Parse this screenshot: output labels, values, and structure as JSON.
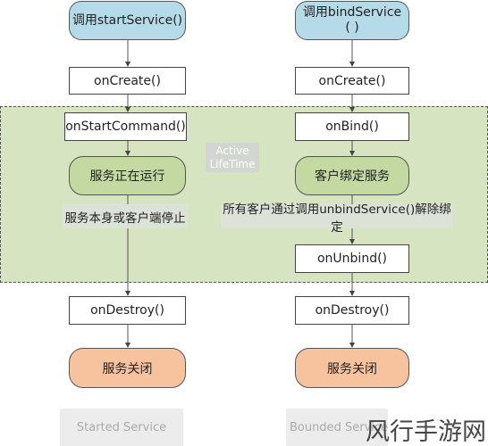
{
  "left": {
    "start": "调用startService()",
    "create": "onCreate()",
    "command": "onStartCommand()",
    "running": "服务正在运行",
    "stop_note": "服务本身或客户端停止",
    "destroy": "onDestroy()",
    "closed": "服务关闭",
    "footer": "Started Service"
  },
  "right": {
    "start": "调用bindService\n( )",
    "create": "onCreate()",
    "bind": "onBind()",
    "bound": "客户绑定服务",
    "unbind_note": "所有客户通过调用unbindService()解除绑定",
    "unbind": "onUnbind()",
    "destroy": "onDestroy()",
    "closed": "服务关闭",
    "footer": "Bounded Service"
  },
  "active_lifetime": "Active\nLifeTime",
  "watermark": "风行手游网",
  "colors": {
    "start": "#b6dbe8",
    "running": "#c4d8a2",
    "closed": "#f7c39e",
    "active_region": "#d6e4c2"
  }
}
